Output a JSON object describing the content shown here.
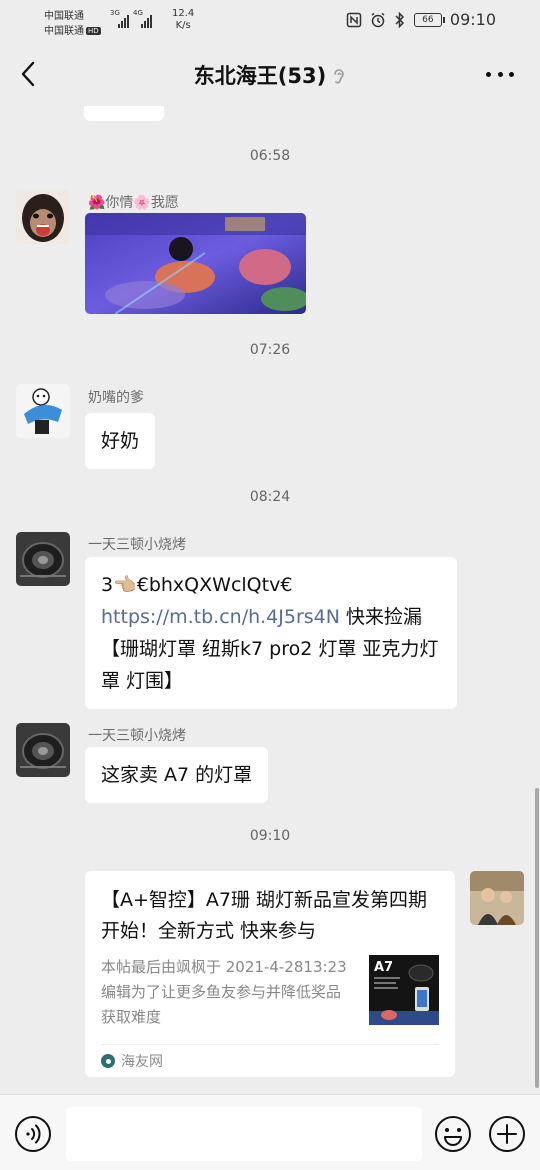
{
  "status_bar": {
    "carrier1": "中国联通",
    "carrier2": "中国联通",
    "hd_badge": "HD",
    "net1": "3G",
    "net2": "4G",
    "speed_value": "12.4",
    "speed_unit": "K/s",
    "battery": "66",
    "clock": "09:10"
  },
  "nav": {
    "title": "东北海王(53)"
  },
  "messages": {
    "time1": "06:58",
    "m1": {
      "sender": "🌺你情🌸我愿"
    },
    "time2": "07:26",
    "m2": {
      "sender": "奶嘴的爹",
      "text": "好奶"
    },
    "time3": "08:24",
    "m3": {
      "sender": "一天三顿小烧烤",
      "text_prefix": "3👈🏼€bhxQXWclQtv€ ",
      "link": "https://m.tb.cn/h.4J5rs4N",
      "text_suffix": " 快来捡漏【珊瑚灯罩 纽斯k7 pro2 灯罩 亚克力灯罩 灯围】"
    },
    "m4": {
      "sender": "一天三顿小烧烤",
      "text": "这家卖 A7 的灯罩"
    },
    "time4": "09:10",
    "card": {
      "title": "【A+智控】A7珊 瑚灯新品宣发第四期开始！全新方式  快来参与",
      "desc": "本帖最后由飒枫于 2021-4-2813:23编辑为了让更多鱼友参与并降低奖品获取难度",
      "source": "海友网",
      "thumb_label": "A7"
    }
  },
  "input": {
    "placeholder": ""
  },
  "icons": {
    "back": "back-arrow-icon",
    "ear": "ear-icon",
    "more": "more-icon",
    "voice": "voice-icon",
    "emoji": "emoji-icon",
    "plus": "plus-icon"
  },
  "colors": {
    "background": "#ededed",
    "bubble": "#ffffff",
    "link": "#576b95"
  }
}
